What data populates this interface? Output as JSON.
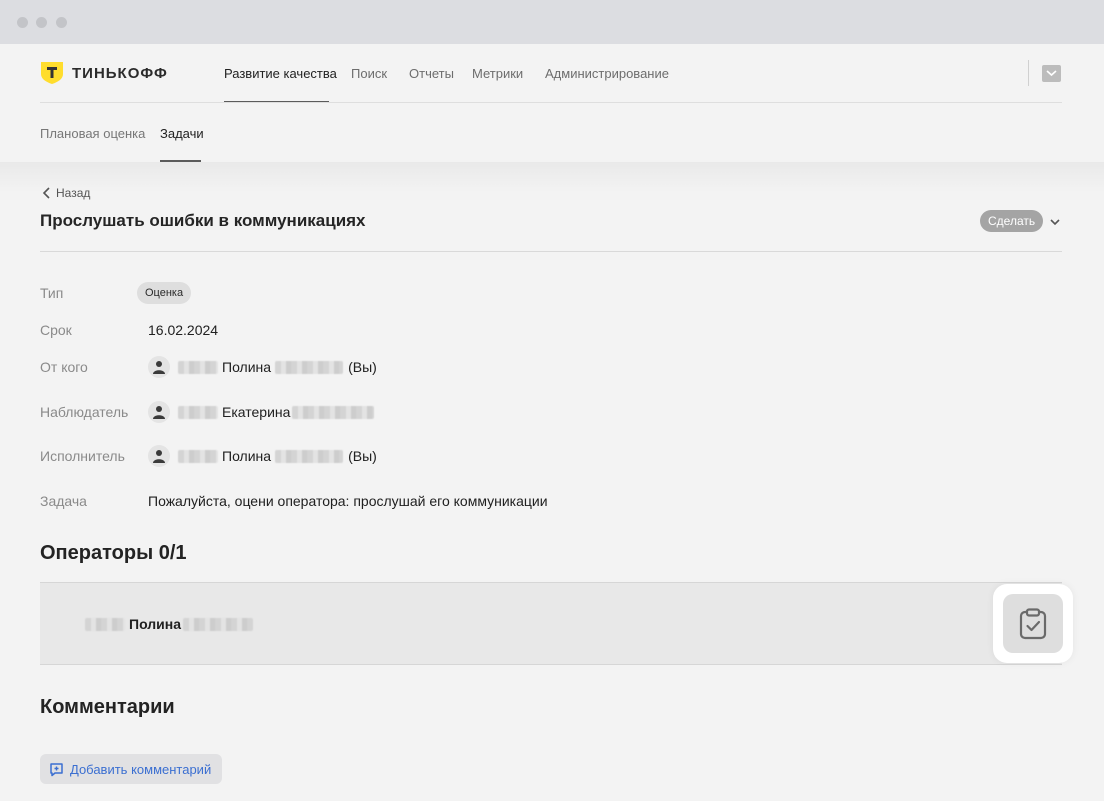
{
  "brand": {
    "name": "ТИНЬКОФФ",
    "accent": "#ffdd2d"
  },
  "nav": {
    "items": [
      {
        "label": "Развитие качества",
        "active": true
      },
      {
        "label": "Поиск",
        "active": false
      },
      {
        "label": "Отчеты",
        "active": false
      },
      {
        "label": "Метрики",
        "active": false
      },
      {
        "label": "Администрирование",
        "active": false
      }
    ]
  },
  "subnav": {
    "items": [
      {
        "label": "Плановая оценка",
        "active": false
      },
      {
        "label": "Задачи",
        "active": true
      }
    ]
  },
  "page": {
    "back_label": "Назад",
    "title": "Прослушать ошибки в коммуникациях",
    "action_label": "Сделать"
  },
  "fields": {
    "type": {
      "label": "Тип",
      "value": "Оценка"
    },
    "deadline": {
      "label": "Срок",
      "value": "16.02.2024"
    },
    "from": {
      "label": "От кого",
      "name": "Полина",
      "suffix": "(Вы)"
    },
    "observer": {
      "label": "Наблюдатель",
      "name": "Екатерина"
    },
    "assignee": {
      "label": "Исполнитель",
      "name": "Полина",
      "suffix": "(Вы)"
    },
    "task": {
      "label": "Задача",
      "value": "Пожалуйста, оцени оператора: прослушай его коммуникации"
    }
  },
  "operators": {
    "title": "Операторы 0/1",
    "items": [
      {
        "name": "Полина"
      }
    ]
  },
  "comments": {
    "title": "Комментарии",
    "add_label": "Добавить комментарий"
  },
  "icons": [
    "mail-icon",
    "chevron-left-icon",
    "chevron-down-icon",
    "user-icon",
    "clipboard-check-icon",
    "comment-add-icon"
  ]
}
